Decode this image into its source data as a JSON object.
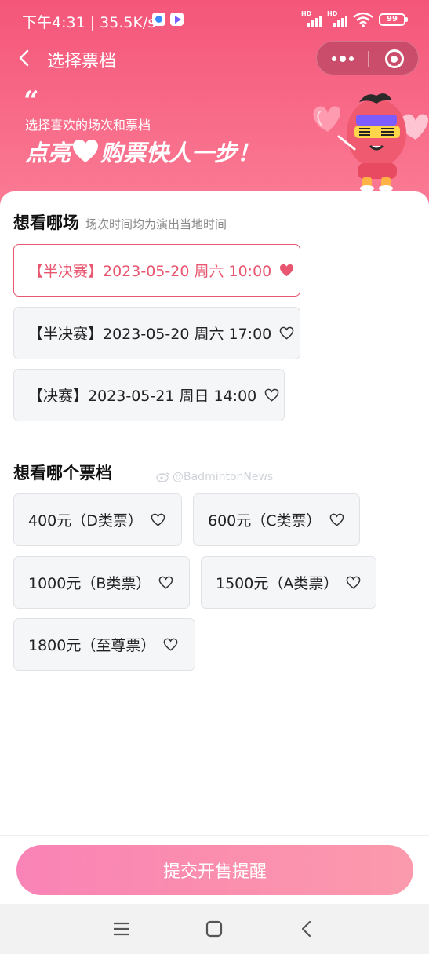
{
  "status_bar": {
    "time": "下午4:31 | 35.5K/s",
    "battery": "99"
  },
  "nav": {
    "title": "选择票档"
  },
  "banner": {
    "quote_mark": "“",
    "subtitle": "选择喜欢的场次和票档",
    "slogan_before": "点亮",
    "slogan_after": "购票快人一步！"
  },
  "session_section": {
    "title": "想看哪场",
    "note": "场次时间均为演出当地时间",
    "options": [
      {
        "label": "【半决赛】2023-05-20 周六 10:00",
        "selected": true
      },
      {
        "label": "【半决赛】2023-05-20 周六 17:00",
        "selected": false
      },
      {
        "label": "【决赛】2023-05-21 周日 14:00",
        "selected": false
      }
    ]
  },
  "tier_section": {
    "title": "想看哪个票档",
    "options": [
      {
        "label": "400元（D类票）",
        "selected": false
      },
      {
        "label": "600元（C类票）",
        "selected": false
      },
      {
        "label": "1000元（B类票）",
        "selected": false
      },
      {
        "label": "1500元（A类票）",
        "selected": false
      },
      {
        "label": "1800元（至尊票）",
        "selected": false
      }
    ]
  },
  "watermark": "@BadmintonNews",
  "footer": {
    "submit_label": "提交开售提醒"
  },
  "colors": {
    "header": "#f4567a",
    "accent": "#e8566f",
    "button_gradient_start": "#f983b6",
    "button_gradient_end": "#fb9aad"
  },
  "icons": [
    "back-arrow-icon",
    "more-dots-icon",
    "close-target-icon",
    "heart-icon",
    "menu-icon",
    "home-square-icon",
    "back-chevron-icon"
  ]
}
